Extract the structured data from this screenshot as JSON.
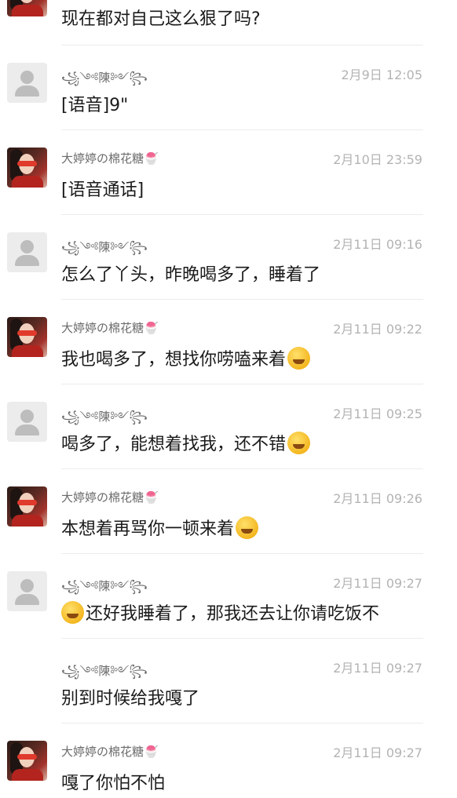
{
  "messages": [
    {
      "sender": "",
      "time": "",
      "text": "现在都对自己这么狠了吗?",
      "avatar": "",
      "emoji": ""
    },
    {
      "sender": "꧁༺陳༻꧂",
      "time": "2月9日 12:05",
      "text": "[语音]9\"",
      "avatar": "default-avatar",
      "emoji": ""
    },
    {
      "sender": "大婷婷の棉花糖🍧",
      "time": "2月10日 23:59",
      "text": "[语音通话]",
      "avatar": "profile-photo",
      "emoji": ""
    },
    {
      "sender": "꧁༺陳༻꧂",
      "time": "2月11日 09:16",
      "text": "怎么了丫头，昨晚喝多了，睡着了",
      "avatar": "default-avatar",
      "emoji": ""
    },
    {
      "sender": "大婷婷の棉花糖🍧",
      "time": "2月11日 09:22",
      "text": "我也喝多了，想找你唠嗑来着",
      "avatar": "profile-photo",
      "emoji": "laughing-tears-emoji"
    },
    {
      "sender": "꧁༺陳༻꧂",
      "time": "2月11日 09:25",
      "text": "喝多了，能想着找我，还不错",
      "avatar": "default-avatar",
      "emoji": "grin-emoji"
    },
    {
      "sender": "大婷婷の棉花糖🍧",
      "time": "2月11日 09:26",
      "text": "本想着再骂你一顿来着",
      "avatar": "profile-photo",
      "emoji": "squint-laugh-emoji"
    },
    {
      "sender": "꧁༺陳༻꧂",
      "time": "2月11日 09:27",
      "text": "还好我睡着了，那我还去让你请吃饭不",
      "avatar": "default-avatar",
      "emoji": "laughing-tears-emoji-lead"
    },
    {
      "sender": "꧁༺陳༻꧂",
      "time": "2月11日 09:27",
      "text": "别到时候给我嘎了",
      "avatar": "",
      "emoji": ""
    },
    {
      "sender": "大婷婷の棉花糖🍧",
      "time": "2月11日 09:27",
      "text": "嘎了你怕不怕",
      "avatar": "profile-photo",
      "emoji": ""
    }
  ]
}
